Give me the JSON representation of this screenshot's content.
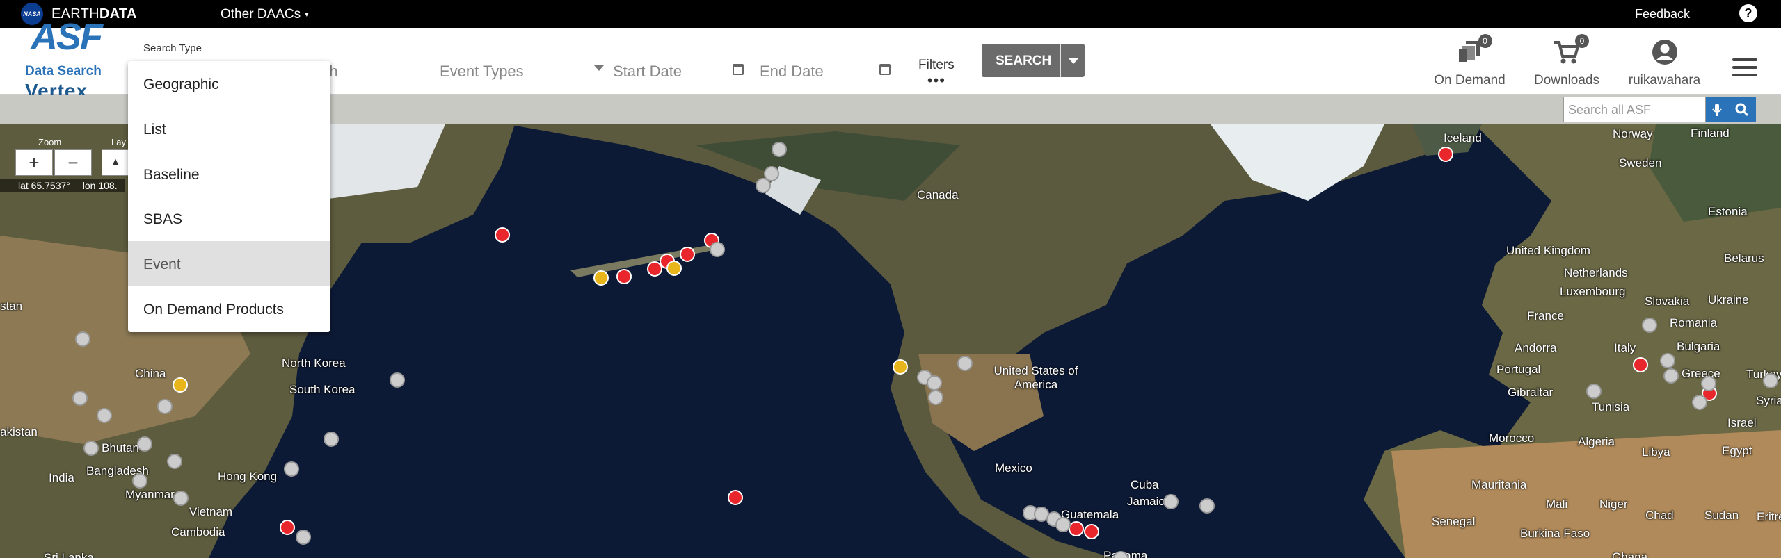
{
  "topbar": {
    "nasa_logo": "NASA",
    "brand_light": "EARTH",
    "brand_bold": "DATA",
    "daacs": "Other DAACs",
    "feedback": "Feedback",
    "help": "?"
  },
  "header": {
    "logo_asf": "ASF",
    "logo_data_search": "Data Search",
    "logo_vertex": "Vertex",
    "search_type_label": "Search Type",
    "search_field_partial": "rch",
    "event_types_placeholder": "Event Types",
    "start_date_placeholder": "Start Date",
    "end_date_placeholder": "End Date",
    "filters_label": "Filters",
    "filters_dots": "•••",
    "search_button": "SEARCH",
    "on_demand": {
      "label": "On Demand",
      "count": "0"
    },
    "downloads": {
      "label": "Downloads",
      "count": "0"
    },
    "user": "ruikawahara",
    "asf_search_placeholder": "Search all ASF"
  },
  "search_type_menu": {
    "items": [
      {
        "label": "Geographic",
        "selected": false
      },
      {
        "label": "List",
        "selected": false
      },
      {
        "label": "Baseline",
        "selected": false
      },
      {
        "label": "SBAS",
        "selected": false
      },
      {
        "label": "Event",
        "selected": true
      },
      {
        "label": "On Demand Products",
        "selected": false
      }
    ]
  },
  "map_controls": {
    "zoom_label": "Zoom",
    "layers_label": "Lay",
    "zoom_in": "+",
    "zoom_out": "−",
    "lat": "lat 65.7537°",
    "lon": "lon 108.",
    "layer_icon": "mountain-icon"
  },
  "map_labels": [
    "Iceland",
    "Norway",
    "Finland",
    "Sweden",
    "Canada",
    "Estonia",
    "United Kingdom",
    "Belarus",
    "Netherlands",
    "Luxembourg",
    "Slovakia",
    "Ukraine",
    "France",
    "Romania",
    "Andorra",
    "Italy",
    "Bulgaria",
    "Portugal",
    "Gibraltar",
    "Tunisia",
    "Greece",
    "Turkey",
    "Syria",
    "Israel",
    "Morocco",
    "Algeria",
    "Libya",
    "Egypt",
    "Mauritania",
    "Mali",
    "Niger",
    "Chad",
    "Sudan",
    "Eritrea",
    "Senegal",
    "Burkina Faso",
    "Ghana",
    "United States of America",
    "Mexico",
    "Cuba",
    "Jamaica",
    "Guatemala",
    "Panama",
    "China",
    "North Korea",
    "South Korea",
    "Hong Kong",
    "India",
    "Bangladesh",
    "Bhutan",
    "Myanmar",
    "Vietnam",
    "Cambodia",
    "Sri Lanka",
    "Pakistan",
    "stan",
    "akistan"
  ],
  "colors": {
    "topbar": "#000000",
    "search_button": "#6b6b6b",
    "asf_blue": "#2b73b8",
    "marker_red": "#e8262b",
    "marker_yellow": "#e8b51a",
    "marker_gray": "#cccccc"
  }
}
